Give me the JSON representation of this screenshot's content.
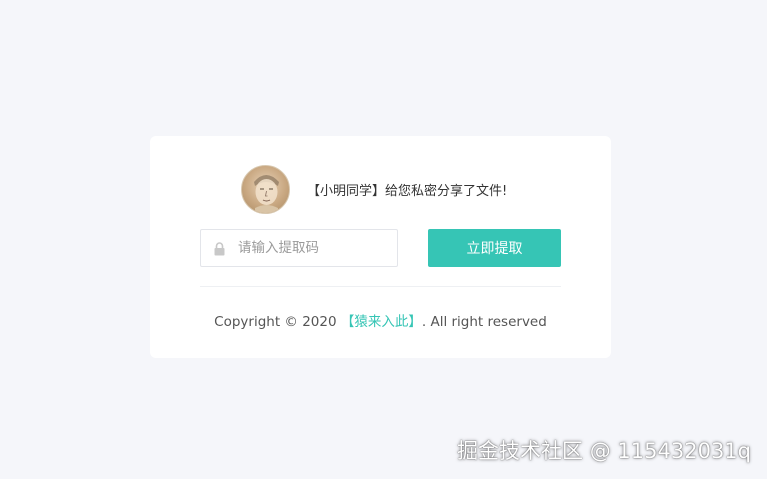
{
  "share": {
    "avatar_alt": "avatar",
    "message": "【小明同学】给您私密分享了文件!"
  },
  "form": {
    "code_placeholder": "请输入提取码",
    "code_value": "",
    "submit_label": "立即提取",
    "lock_icon": "lock-icon"
  },
  "footer": {
    "copyright_prefix": "Copyright © 2020 ",
    "brand": "【猿来入此】",
    "suffix": ". All right reserved"
  },
  "watermark": "掘金技术社区 @ 115432031q",
  "colors": {
    "accent": "#36c5b5",
    "background": "#f5f6fa",
    "card": "#ffffff"
  }
}
